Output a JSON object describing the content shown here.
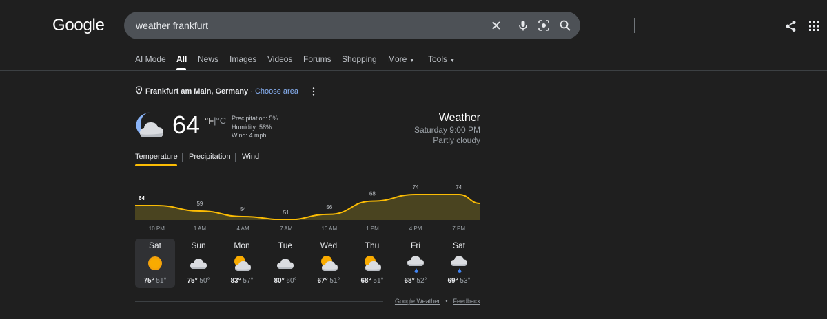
{
  "header": {
    "logo": "Google",
    "search_value": "weather frankfurt",
    "icons": [
      "clear-icon",
      "mic-icon",
      "lens-icon",
      "search-icon",
      "share-icon",
      "apps-icon"
    ]
  },
  "tabs": [
    "AI Mode",
    "All",
    "News",
    "Images",
    "Videos",
    "Forums",
    "Shopping",
    "More",
    "Tools"
  ],
  "active_tab": "All",
  "location": {
    "name": "Frankfurt am Main, Germany",
    "separator": "·",
    "choose": "Choose area"
  },
  "current": {
    "temp": "64",
    "unit_f": "°F",
    "unit_sep": "|",
    "unit_c": "°C",
    "precipitation": "Precipitation: 5%",
    "humidity": "Humidity: 58%",
    "wind": "Wind: 4 mph",
    "title": "Weather",
    "time": "Saturday 9:00 PM",
    "condition": "Partly cloudy"
  },
  "metric_tabs": [
    "Temperature",
    "Precipitation",
    "Wind"
  ],
  "chart_data": {
    "type": "area",
    "x": [
      "10 PM",
      "1 AM",
      "4 AM",
      "7 AM",
      "10 AM",
      "1 PM",
      "4 PM",
      "7 PM"
    ],
    "values": [
      64,
      59,
      54,
      51,
      56,
      68,
      74,
      74
    ],
    "labels": [
      "64",
      "59",
      "54",
      "51",
      "56",
      "68",
      "74",
      "74"
    ],
    "colors": {
      "line": "#fbbc04",
      "fill": "#4a4420"
    }
  },
  "days": [
    {
      "name": "Sat",
      "hi": "75°",
      "lo": "51°",
      "icon": "sunny"
    },
    {
      "name": "Sun",
      "hi": "75°",
      "lo": "50°",
      "icon": "cloudy"
    },
    {
      "name": "Mon",
      "hi": "83°",
      "lo": "57°",
      "icon": "partly-cloudy"
    },
    {
      "name": "Tue",
      "hi": "80°",
      "lo": "60°",
      "icon": "cloudy"
    },
    {
      "name": "Wed",
      "hi": "67°",
      "lo": "51°",
      "icon": "partly-cloudy"
    },
    {
      "name": "Thu",
      "hi": "68°",
      "lo": "51°",
      "icon": "partly-cloudy"
    },
    {
      "name": "Fri",
      "hi": "68°",
      "lo": "52°",
      "icon": "showers"
    },
    {
      "name": "Sat",
      "hi": "69°",
      "lo": "53°",
      "icon": "showers"
    }
  ],
  "footer": {
    "source": "Google Weather",
    "dot": "•",
    "feedback": "Feedback"
  }
}
